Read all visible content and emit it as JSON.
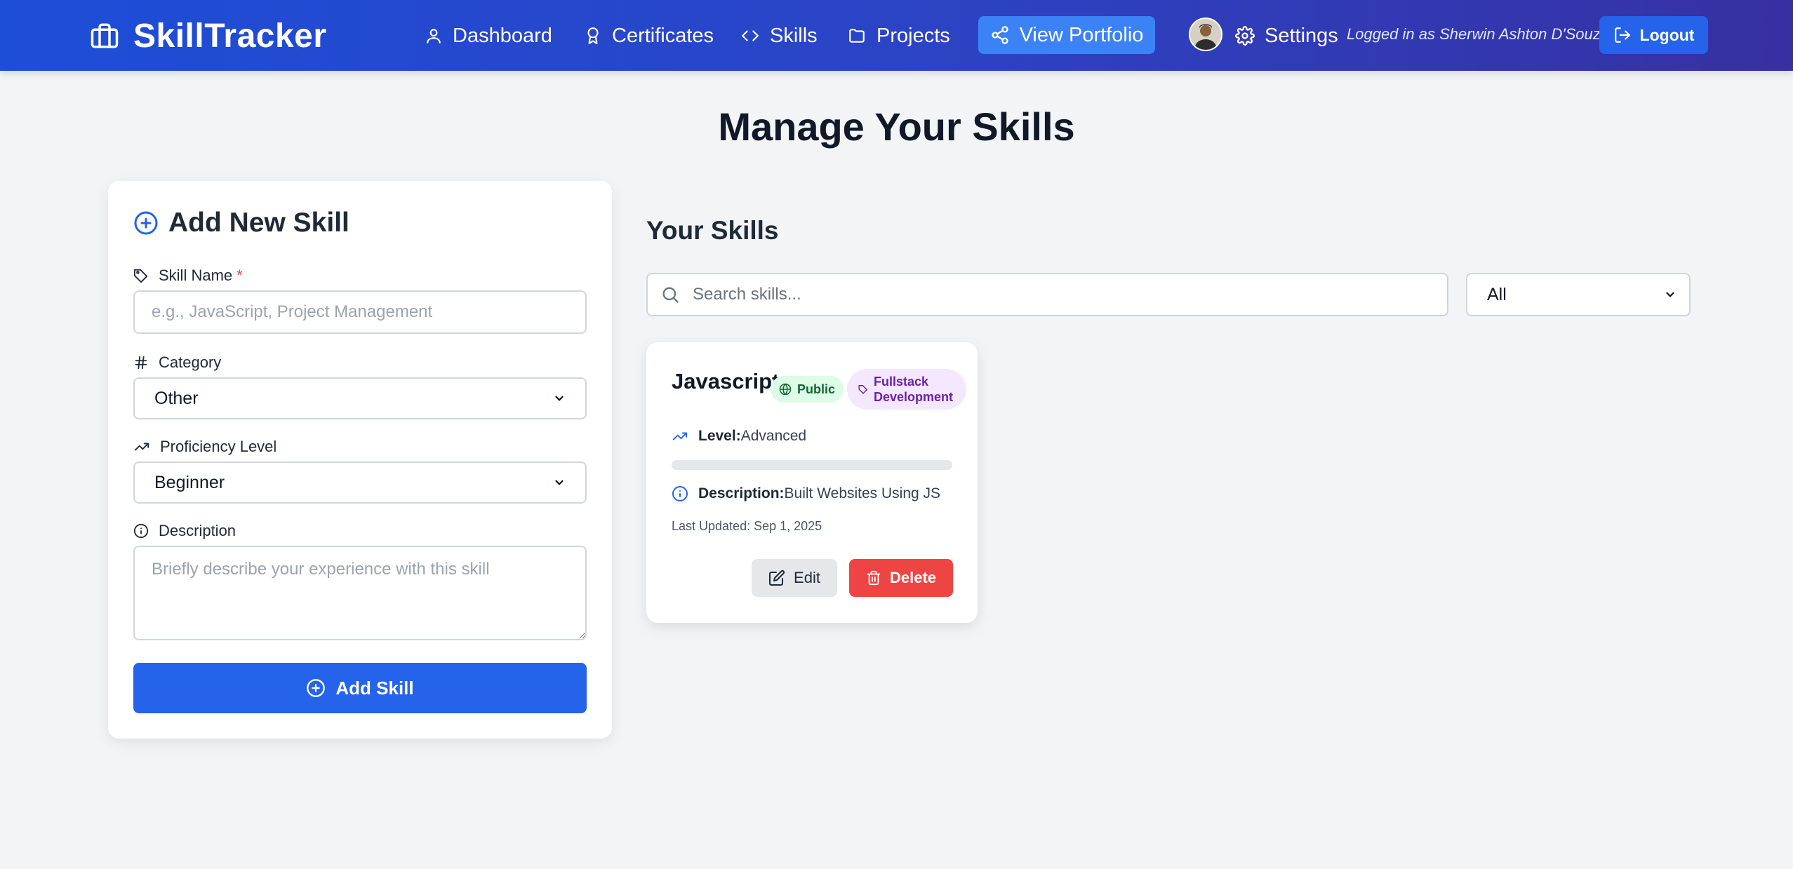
{
  "nav": {
    "brand": "SkillTracker",
    "links": [
      {
        "label": "Dashboard",
        "icon": "user-icon"
      },
      {
        "label": "Certificates",
        "icon": "award-icon"
      },
      {
        "label": "Skills",
        "icon": "code-icon"
      },
      {
        "label": "Projects",
        "icon": "folder-icon"
      }
    ],
    "portfolio_label": "View Portfolio",
    "settings_label": "Settings",
    "logged_in_text": "Logged in as Sherwin Ashton D'Souza",
    "logout_label": "Logout",
    "colors": {
      "gradient_start": "#1d4ed8",
      "gradient_end": "#3730a3",
      "portfolio_bg": "#3b82f6"
    }
  },
  "page": {
    "title": "Manage Your Skills"
  },
  "add_form": {
    "heading": "Add New Skill",
    "skill_name_label": "Skill Name",
    "required_marker": "*",
    "skill_name_placeholder": "e.g., JavaScript, Project Management",
    "skill_name_value": "",
    "category_label": "Category",
    "category_value": "Other",
    "proficiency_label": "Proficiency Level",
    "proficiency_value": "Beginner",
    "description_label": "Description",
    "description_placeholder": "Briefly describe your experience with this skill",
    "submit_label": "Add Skill"
  },
  "skills_section": {
    "title": "Your Skills",
    "search_placeholder": "Search skills...",
    "filter_value": "All"
  },
  "skills": [
    {
      "name": "Javascript",
      "visibility": "Public",
      "category": "Fullstack Development",
      "level_label": "Level:",
      "level": "Advanced",
      "description_label": "Description:",
      "description": "Built Websites Using JS",
      "updated": "Last Updated: Sep 1, 2025",
      "edit_label": "Edit",
      "delete_label": "Delete"
    }
  ]
}
